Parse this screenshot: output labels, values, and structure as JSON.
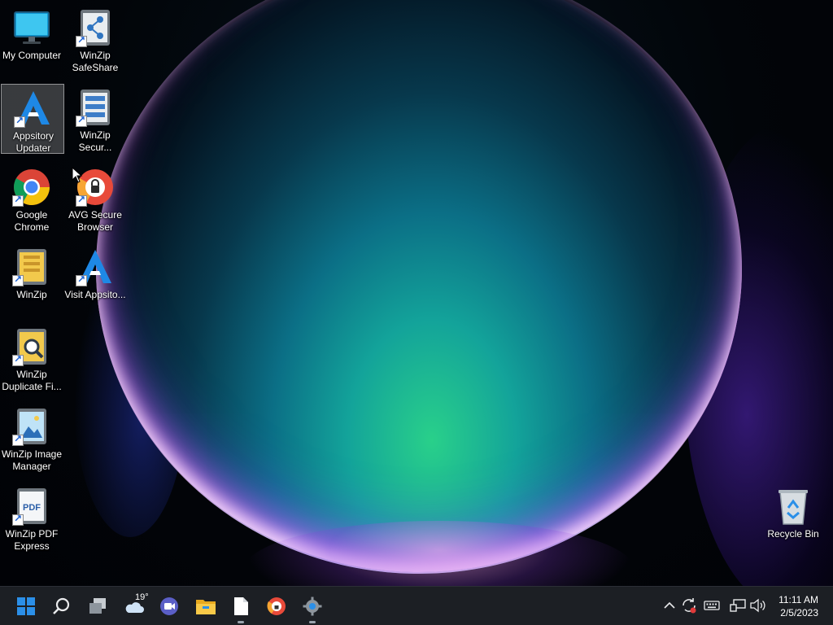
{
  "desktop": {
    "icons": [
      {
        "name": "my-computer",
        "label": "My Computer"
      },
      {
        "name": "winzip-safeshare",
        "label": "WinZip SafeShare"
      },
      {
        "name": "appsitory-updater",
        "label": "Appsitory Updater"
      },
      {
        "name": "winzip-secure",
        "label": "WinZip Secur..."
      },
      {
        "name": "google-chrome",
        "label": "Google Chrome"
      },
      {
        "name": "avg-secure-browser",
        "label": "AVG Secure Browser"
      },
      {
        "name": "winzip",
        "label": "WinZip"
      },
      {
        "name": "visit-appsitory",
        "label": "Visit Appsito..."
      },
      {
        "name": "winzip-duplicate-finder",
        "label": "WinZip Duplicate Fi..."
      },
      {
        "name": "winzip-image-manager",
        "label": "WinZip Image Manager"
      },
      {
        "name": "winzip-pdf-express",
        "label": "WinZip PDF Express"
      },
      {
        "name": "recycle-bin",
        "label": "Recycle Bin"
      }
    ],
    "selected": "Appsitory Updater"
  },
  "taskbar": {
    "items": [
      "start-icon",
      "search-icon",
      "task-view-icon",
      "weather-widget",
      "meet-icon",
      "file-explorer-icon",
      "notepad-icon",
      "avg-browser-icon",
      "settings-icon"
    ],
    "weather_temp": "19°",
    "tray_icons": [
      "chevron-up-icon",
      "sync-alert-icon",
      "keyboard-icon",
      "network-icon",
      "volume-icon"
    ]
  },
  "clock": {
    "time": "11:11 AM",
    "date": "2/5/2023"
  },
  "colors": {
    "taskbar_bg": "#1c1f24",
    "windows_blue": "#2b8fe8",
    "accent_purple": "#8a4cff"
  }
}
